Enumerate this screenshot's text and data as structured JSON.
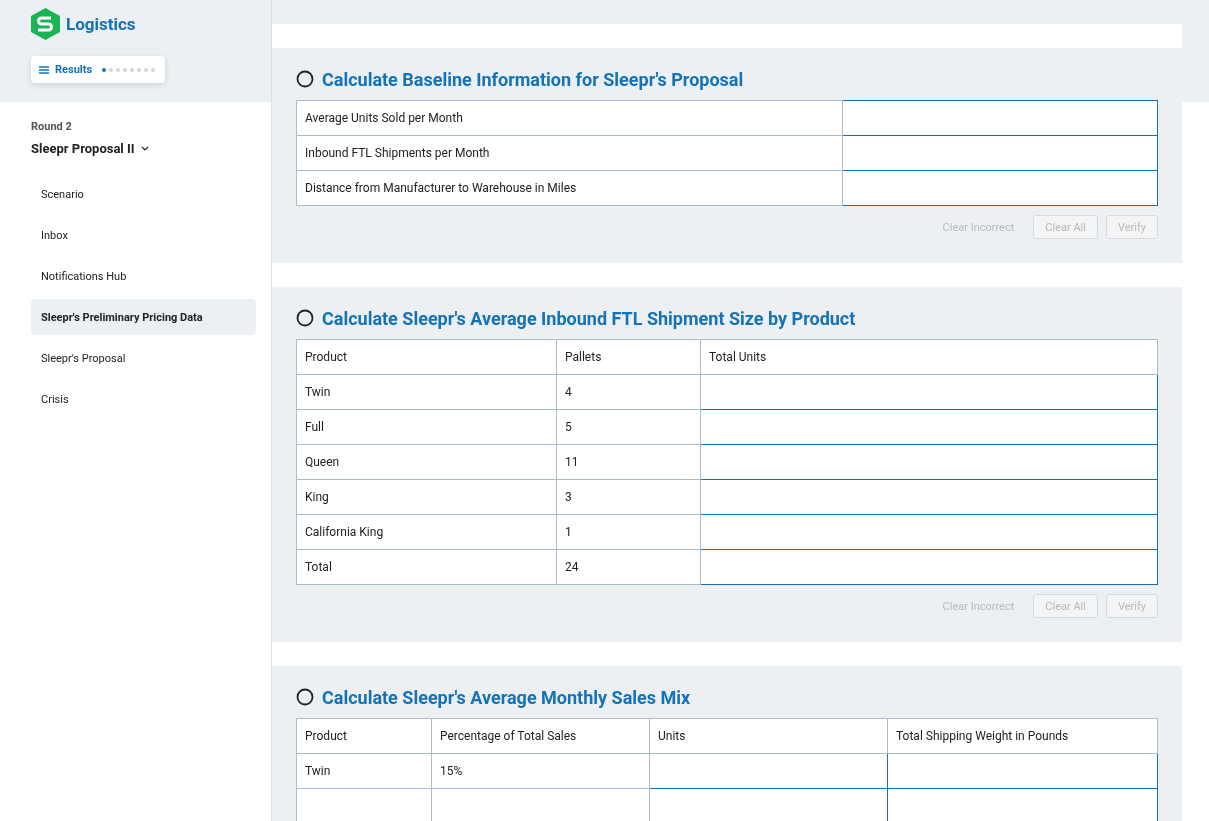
{
  "brand": {
    "name": "Logistics"
  },
  "results_button": {
    "label": "Results",
    "steps": [
      {
        "selected": true
      },
      {
        "selected": false
      },
      {
        "selected": false
      },
      {
        "selected": false
      },
      {
        "selected": false
      },
      {
        "selected": false
      },
      {
        "selected": false
      },
      {
        "selected": false
      }
    ]
  },
  "sidebar": {
    "round": "Round 2",
    "title": "Sleepr Proposal II",
    "items": [
      {
        "label": "Scenario",
        "selected": false
      },
      {
        "label": "Inbox",
        "selected": false
      },
      {
        "label": "Notifications Hub",
        "selected": false
      },
      {
        "label": "Sleepr's Preliminary Pricing Data",
        "selected": true
      },
      {
        "label": "Sleepr's Proposal",
        "selected": false
      },
      {
        "label": "Crisis",
        "selected": false
      }
    ]
  },
  "sections": [
    {
      "title": "Calculate Baseline Information for Sleepr's Proposal",
      "rows": [
        [
          {
            "kind": "text",
            "text": "Average Units Sold per Month"
          },
          {
            "kind": "input"
          }
        ],
        [
          {
            "kind": "text",
            "text": "Inbound FTL Shipments per Month"
          },
          {
            "kind": "input"
          }
        ],
        [
          {
            "kind": "text",
            "text": "Distance from Manufacturer to Warehouse in Miles"
          },
          {
            "kind": "input"
          }
        ]
      ],
      "buttons": [
        {
          "kind": "link",
          "label": "Clear Incorrect",
          "disabled": true
        },
        {
          "kind": "outlined",
          "label": "Clear All",
          "disabled": true
        },
        {
          "kind": "outlined",
          "label": "Verify",
          "disabled": true
        }
      ]
    },
    {
      "title": "Calculate Sleepr's Average Inbound FTL Shipment Size by Product",
      "header": [
        "Product",
        "Pallets",
        "Total Units"
      ],
      "rows": [
        [
          {
            "kind": "text",
            "text": "Twin"
          },
          {
            "kind": "text",
            "text": "4"
          },
          {
            "kind": "input"
          }
        ],
        [
          {
            "kind": "text",
            "text": "Full"
          },
          {
            "kind": "text",
            "text": "5"
          },
          {
            "kind": "input"
          }
        ],
        [
          {
            "kind": "text",
            "text": "Queen"
          },
          {
            "kind": "text",
            "text": "11"
          },
          {
            "kind": "input"
          }
        ],
        [
          {
            "kind": "text",
            "text": "King"
          },
          {
            "kind": "text",
            "text": "3"
          },
          {
            "kind": "input"
          }
        ],
        [
          {
            "kind": "text",
            "text": "California King"
          },
          {
            "kind": "text",
            "text": "1"
          },
          {
            "kind": "input"
          }
        ],
        [
          {
            "kind": "text",
            "text": "Total"
          },
          {
            "kind": "text",
            "text": "24"
          },
          {
            "kind": "input"
          }
        ]
      ],
      "buttons": [
        {
          "kind": "link",
          "label": "Clear Incorrect",
          "disabled": true
        },
        {
          "kind": "outlined",
          "label": "Clear All",
          "disabled": true
        },
        {
          "kind": "outlined",
          "label": "Verify",
          "disabled": true
        }
      ]
    },
    {
      "title": "Calculate Sleepr's Average Monthly Sales Mix",
      "header": [
        "Product",
        "Percentage of Total Sales",
        "Units",
        "Total Shipping Weight in Pounds"
      ],
      "rows": [
        [
          {
            "kind": "text",
            "text": "Twin"
          },
          {
            "kind": "text",
            "text": "15%"
          },
          {
            "kind": "input"
          },
          {
            "kind": "input"
          }
        ],
        [
          {
            "kind": "blank"
          },
          {
            "kind": "blank"
          },
          {
            "kind": "input"
          },
          {
            "kind": "input"
          }
        ]
      ]
    }
  ]
}
